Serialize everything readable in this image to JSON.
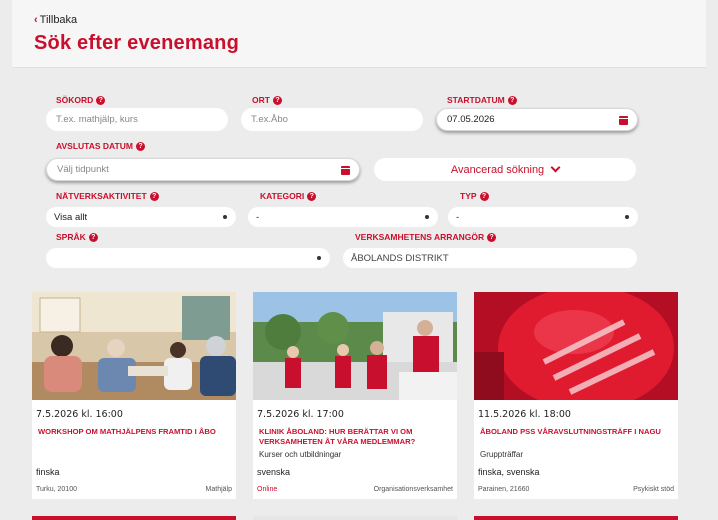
{
  "header": {
    "back_label": "Tillbaka",
    "title": "Sök efter evenemang"
  },
  "search": {
    "keyword_label": "SÖKORD",
    "keyword_placeholder": "T.ex. mathjälp, kurs",
    "place_label": "ORT",
    "place_placeholder": "T.ex.Åbo",
    "start_label": "STARTDATUM",
    "start_value": "07.05.2026",
    "end_label": "AVSLUTAS DATUM",
    "end_placeholder": "Välj tidpunkt",
    "advanced_label": "Avancerad sökning",
    "network_label": "NÄTVERKSAKTIVITET",
    "network_value": "Visa allt",
    "category_label": "KATEGORI",
    "category_value": "-",
    "type_label": "TYP",
    "type_value": "-",
    "language_label": "SPRÅK",
    "language_value": "",
    "organizer_label": "VERKSAMHETENS ARRANGÖR",
    "organizer_value": "ÅBOLANDS DISTRIKT"
  },
  "cards": [
    {
      "date": "7.5.2026 kl. 16:00",
      "title": "WORKSHOP OM MATHJÄLPENS FRAMTID I ÅBO",
      "category": "",
      "language": "finska",
      "place": "Turku, 20100",
      "tag": "Mathjälp"
    },
    {
      "date": "7.5.2026 kl. 17:00",
      "title": "KLINIK ÅBOLAND: HUR BERÄTTAR VI OM VERKSAMHETEN ÅT VÅRA MEDLEMMAR?",
      "category": "Kurser och utbildningar",
      "language": "svenska",
      "place": "Online",
      "tag": "Organisationsverksamhet"
    },
    {
      "date": "11.5.2026 kl. 18:00",
      "title": "ÅBOLAND PSS VÅRAVSLUTNINGSTRÄFF I NAGU",
      "category": "Gruppträffar",
      "language": "finska, svenska",
      "place": "Parainen, 21660",
      "tag": "Psykiskt stöd"
    }
  ],
  "colors": {
    "accent": "#c8102e",
    "background": "#ececec"
  }
}
